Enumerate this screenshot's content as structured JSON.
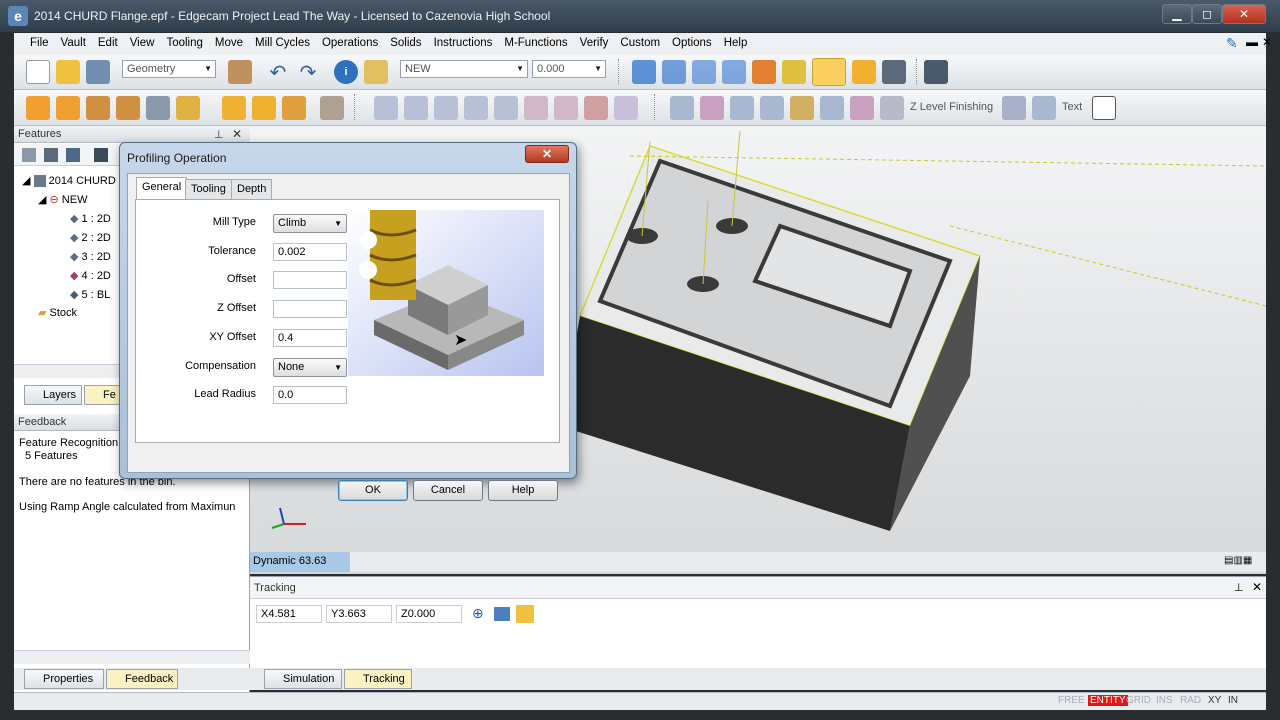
{
  "window": {
    "title": "2014 CHURD Flange.epf - Edgecam Project Lead The Way - Licensed to Cazenovia High School",
    "app_icon": "e",
    "min_label": "▁",
    "max_label": "◻",
    "close_label": "✕"
  },
  "menu": [
    "File",
    "Vault",
    "Edit",
    "View",
    "Tooling",
    "Move",
    "Mill Cycles",
    "Operations",
    "Solids",
    "Instructions",
    "M-Functions",
    "Verify",
    "Custom",
    "Options",
    "Help"
  ],
  "toolbar": {
    "geometry_combo": "Geometry",
    "layer_combo": "NEW",
    "value_combo": "0.000",
    "z_level_label": "Z Level Finishing",
    "text_label": "Text"
  },
  "left_panel": {
    "features_header": "Features",
    "tree": {
      "root": "2014 CHURD",
      "new_node": "NEW",
      "features": [
        "1 : 2D",
        "2 : 2D",
        "3 : 2D",
        "4 : 2D",
        "5 : BL"
      ],
      "stock": "Stock"
    },
    "tabs": [
      "Layers",
      "Fe"
    ],
    "feedback_header": "Feedback",
    "feedback_lines": [
      "Feature Recognition",
      "5 Features",
      "There are no features in the bin.",
      "Using Ramp Angle calculated from Maximun"
    ]
  },
  "viewport": {
    "dynamic_label": "Dynamic 63.63"
  },
  "tracking": {
    "header": "Tracking",
    "x": "X4.581",
    "y": "Y3.663",
    "z": "Z0.000"
  },
  "bottom_tabs": {
    "properties": "Properties",
    "feedback": "Feedback",
    "simulation": "Simulation",
    "tracking": "Tracking"
  },
  "status": [
    "FREE",
    "ENTITY",
    "GRID",
    "INS",
    "RAD",
    "XY",
    "IN"
  ],
  "dialog": {
    "title": "Profiling Operation",
    "tabs": [
      "General",
      "Tooling",
      "Depth"
    ],
    "fields": {
      "mill_type_label": "Mill Type",
      "mill_type_value": "Climb",
      "tolerance_label": "Tolerance",
      "tolerance_value": "0.002",
      "offset_label": "Offset",
      "offset_value": "",
      "z_offset_label": "Z Offset",
      "z_offset_value": "",
      "xy_offset_label": "XY Offset",
      "xy_offset_value": "0.4",
      "compensation_label": "Compensation",
      "compensation_value": "None",
      "lead_radius_label": "Lead Radius",
      "lead_radius_value": "0.0"
    },
    "buttons": {
      "ok": "OK",
      "cancel": "Cancel",
      "help": "Help"
    }
  },
  "colors": {
    "accent_blue": "#a8c8e8",
    "entity_red": "#e01818",
    "highlight_yellow": "#fbf1c2"
  }
}
